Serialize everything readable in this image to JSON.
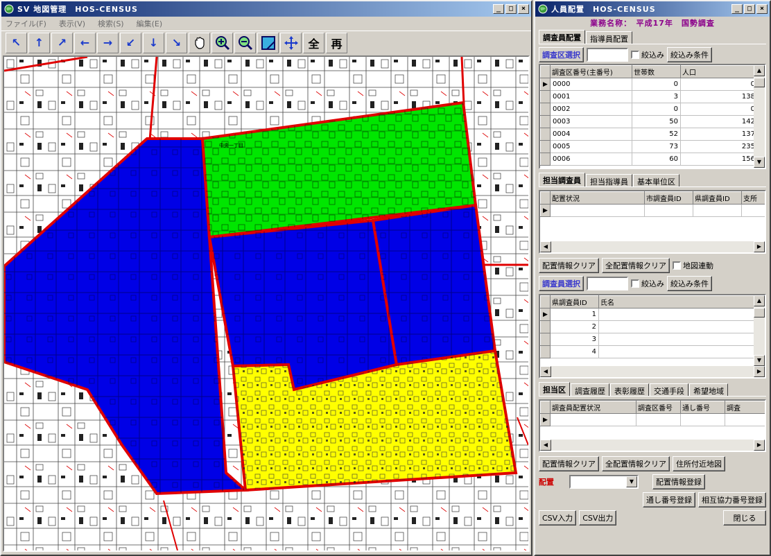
{
  "map_window": {
    "title": "SV 地図管理　HOS-CENSUS",
    "menu": [
      "ファイル(F)",
      "表示(V)",
      "検索(S)",
      "編集(E)"
    ],
    "toolbar": {
      "arrows": [
        "↖",
        "↑",
        "↗",
        "←",
        "→",
        "↙",
        "↓",
        "↘"
      ],
      "all_label": "全",
      "redraw_label": "再"
    },
    "zone_colors": {
      "blue": "#0000e6",
      "green": "#00e600",
      "yellow": "#ffff00",
      "border": "#e00000"
    },
    "map_labels": [
      "中央一丁目"
    ]
  },
  "survey_window": {
    "title": "人員配置　HOS-CENSUS",
    "task_name": "業務名称：　平成17年　国勢調査",
    "top_tabs": [
      "調査員配置",
      "指導員配置"
    ],
    "district_select": {
      "label": "調査区選択",
      "value": "",
      "filter_checkbox": "絞込み",
      "filter_button": "絞込み条件"
    },
    "district_table": {
      "columns": [
        "調査区番号(主番号)",
        "世帯数",
        "人口"
      ],
      "rows": [
        [
          "0000",
          "0",
          "0"
        ],
        [
          "0001",
          "3",
          "138"
        ],
        [
          "0002",
          "0",
          "0"
        ],
        [
          "0003",
          "50",
          "142"
        ],
        [
          "0004",
          "52",
          "137"
        ],
        [
          "0005",
          "73",
          "235"
        ],
        [
          "0006",
          "60",
          "156"
        ]
      ]
    },
    "mid_tabs": [
      "担当調査員",
      "担当指導員",
      "基本単位区"
    ],
    "assign_table": {
      "columns": [
        "配置状況",
        "市調査員ID",
        "県調査員ID",
        "支所"
      ]
    },
    "assign_actions": {
      "clear": "配置情報クリア",
      "clear_all": "全配置情報クリア",
      "map_link": "地図連動"
    },
    "surveyor_select": {
      "label": "調査員選択",
      "value": "",
      "filter_checkbox": "絞込み",
      "filter_button": "絞込み条件"
    },
    "surveyor_table": {
      "columns": [
        "県調査員ID",
        "氏名"
      ],
      "rows": [
        [
          "1",
          ""
        ],
        [
          "2",
          ""
        ],
        [
          "3",
          ""
        ],
        [
          "4",
          ""
        ]
      ]
    },
    "lower_tabs": [
      "担当区",
      "調査履歴",
      "表彰履歴",
      "交通手段",
      "希望地域"
    ],
    "assigned_table": {
      "columns": [
        "調査員配置状況",
        "調査区番号",
        "通し番号",
        "調査"
      ]
    },
    "bottom_actions": {
      "clear": "配置情報クリア",
      "clear_all": "全配置情報クリア",
      "nearby_map": "住所付近地図",
      "assign_label": "配置",
      "assign_value": "",
      "register": "配置情報登録",
      "serial_register": "通し番号登録",
      "mutual_register": "相互協力番号登録",
      "csv_in": "CSV入力",
      "csv_out": "CSV出力",
      "close": "閉じる"
    }
  }
}
